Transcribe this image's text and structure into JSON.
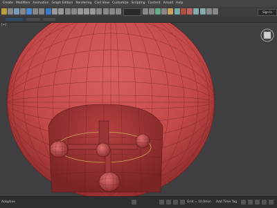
{
  "menubar": {
    "items": [
      "Create",
      "Modifiers",
      "Animation",
      "Graph Editors",
      "Rendering",
      "Civil View",
      "Customize",
      "Scripting",
      "Content",
      "Arnold",
      "Help"
    ]
  },
  "toolbar": {
    "workspace_label": "Sign In"
  },
  "viewport": {
    "label": "[+]"
  },
  "statusbar": {
    "left_text": "Adaptive",
    "coords_text": "Grid = 10.0mm",
    "time_tag": "Add Time Tag"
  },
  "colors": {
    "sphere": "#c94a4a",
    "sphere_dark": "#8a2a2a",
    "wire": "#6b1e1e",
    "selection": "#e0c060"
  }
}
